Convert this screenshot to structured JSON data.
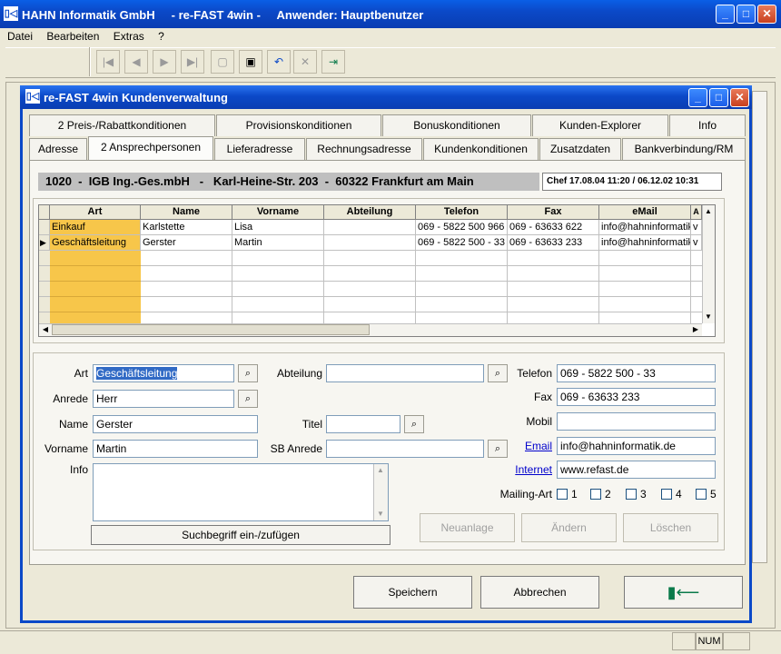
{
  "app": {
    "title": "HAHN Informatik GmbH     - re-FAST 4win -     Anwender: Hauptbenutzer"
  },
  "menu": [
    "Datei",
    "Bearbeiten",
    "Extras",
    "?"
  ],
  "dialog": {
    "title": "re-FAST 4win Kundenverwaltung"
  },
  "tabs_row1": [
    "2 Preis-/Rabattkonditionen",
    "Provisionskonditionen",
    "Bonuskonditionen",
    "Kunden-Explorer",
    "Info"
  ],
  "tabs_row2": [
    "Adresse",
    "2 Ansprechpersonen",
    "Lieferadresse",
    "Rechnungsadresse",
    "Kundenkonditionen",
    "Zusatzdaten",
    "Bankverbindung/RM"
  ],
  "customer_line": "1020  -  IGB Ing.-Ges.mbH   -   Karl-Heine-Str. 203  -  60322 Frankfurt am Main",
  "customer_meta": "Chef 17.08.04 11:20 / 06.12.02 10:31",
  "grid": {
    "columns": [
      "Art",
      "Name",
      "Vorname",
      "Abteilung",
      "Telefon",
      "Fax",
      "eMail",
      "A"
    ],
    "rows": [
      [
        "Einkauf",
        "Karlstette",
        "Lisa",
        "",
        "069 - 5822 500 966",
        "069 - 63633 622",
        "info@hahninformatik",
        "v"
      ],
      [
        "Geschäftsleitung",
        "Gerster",
        "Martin",
        "",
        "069 - 5822 500 - 33",
        "069 - 63633 233",
        "info@hahninformatik",
        "v"
      ]
    ]
  },
  "form": {
    "art_label": "Art",
    "art_value": "Geschäftsleitung",
    "anrede_label": "Anrede",
    "anrede_value": "Herr",
    "name_label": "Name",
    "name_value": "Gerster",
    "vorname_label": "Vorname",
    "vorname_value": "Martin",
    "info_label": "Info",
    "abteilung_label": "Abteilung",
    "abteilung_value": "",
    "titel_label": "Titel",
    "titel_value": "",
    "sbanrede_label": "SB Anrede",
    "sbanrede_value": "",
    "telefon_label": "Telefon",
    "telefon_value": "069 - 5822 500 - 33",
    "fax_label": "Fax",
    "fax_value": "069 - 63633 233",
    "mobil_label": "Mobil",
    "mobil_value": "",
    "email_label": "Email",
    "email_value": "info@hahninformatik.de",
    "internet_label": "Internet",
    "internet_value": "www.refast.de",
    "mailing_label": "Mailing-Art",
    "mailing_options": [
      "1",
      "2",
      "3",
      "4",
      "5"
    ],
    "suchbegriff_button": "Suchbegriff ein-/zufügen",
    "neuanlage_button": "Neuanlage",
    "aendern_button": "Ändern",
    "loeschen_button": "Löschen"
  },
  "footer": {
    "speichern": "Speichern",
    "abbrechen": "Abbrechen"
  },
  "status": {
    "num": "NUM"
  }
}
